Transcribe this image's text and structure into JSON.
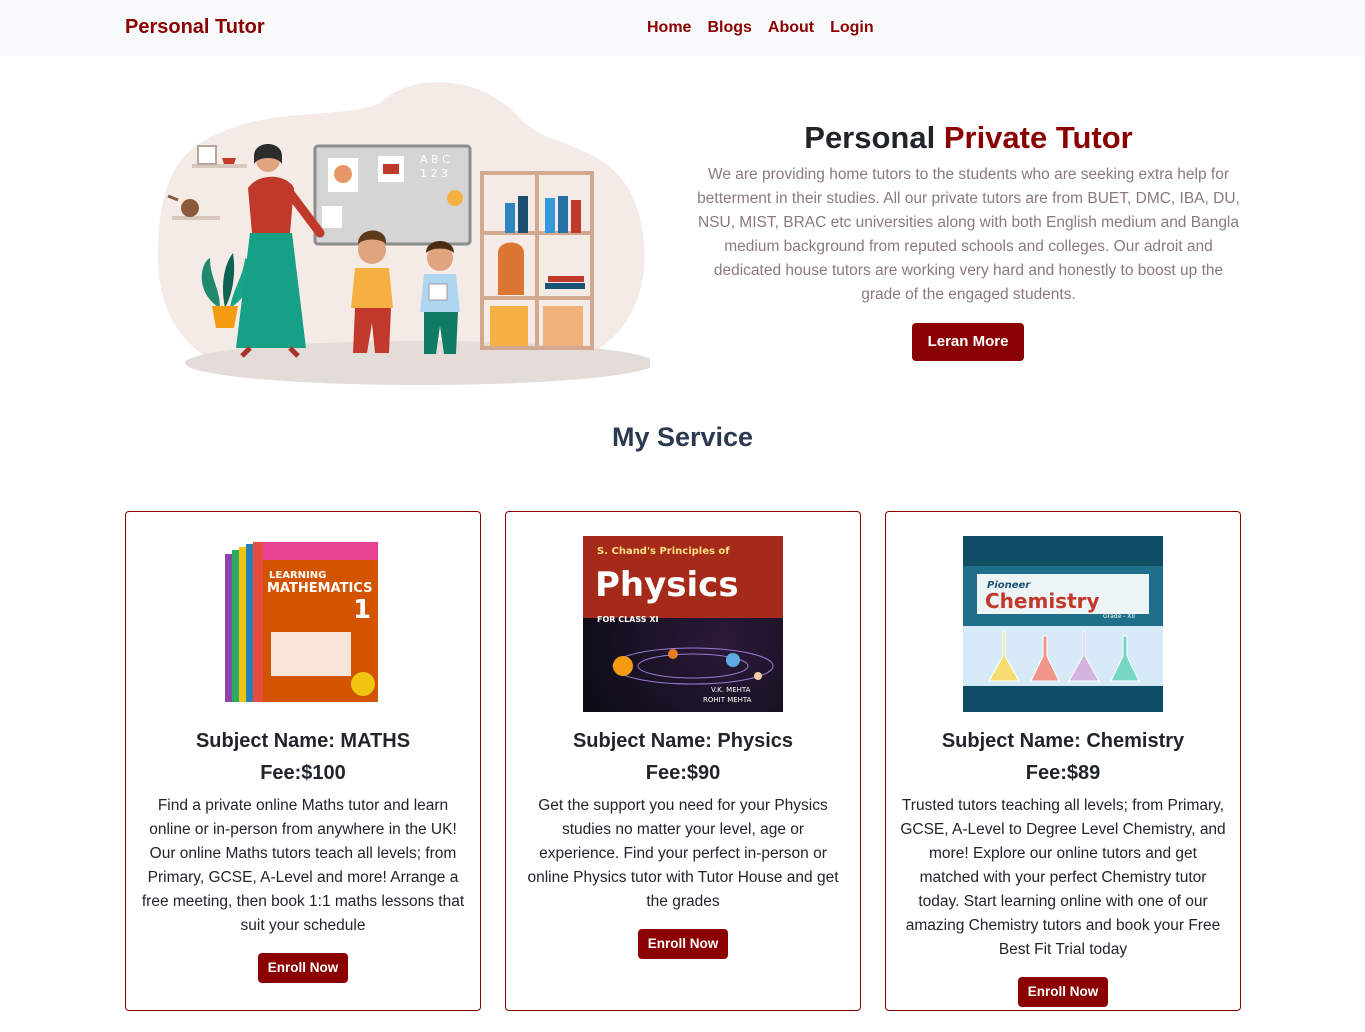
{
  "nav": {
    "brand": "Personal Tutor",
    "links": [
      "Home",
      "Blogs",
      "About",
      "Login"
    ]
  },
  "hero": {
    "title_part1": "Personal ",
    "title_part2": "Private Tutor",
    "description": "We are providing home tutors to the students who are seeking extra help for betterment in their studies. All our private tutors are from BUET, DMC, IBA, DU, NSU, MIST, BRAC etc universities along with both English medium and Bangla medium background from reputed schools and colleges. Our adroit and dedicated house tutors are working very hard and honestly to boost up the grade of the engaged students.",
    "button": "Leran More",
    "illustration_board_text": [
      "A B C",
      "1 2 3"
    ]
  },
  "services": {
    "title": "My Service",
    "cards": [
      {
        "subject": "Subject Name: MATHS",
        "fee": "Fee:$100",
        "description": "Find a private online Maths tutor and learn online or in-person from anywhere in the UK! Our online Maths tutors teach all levels; from Primary, GCSE, A-Level and more! Arrange a free meeting, then book 1:1 maths lessons that suit your schedule",
        "button": "Enroll Now",
        "book_title_line1": "LEARNING",
        "book_title_line2": "MATHEMATICS",
        "book_number": "1"
      },
      {
        "subject": "Subject Name: Physics",
        "fee": "Fee:$90",
        "description": "Get the support you need for your Physics studies no matter your level, age or experience. Find your perfect in-person or online Physics tutor with Tutor House and get the grades",
        "button": "Enroll Now",
        "book_title_line1": "S. Chand's Principles of",
        "book_title_line2": "Physics",
        "book_subtitle": "FOR CLASS XI",
        "book_authors": [
          "V.K. MEHTA",
          "ROHIT MEHTA"
        ]
      },
      {
        "subject": "Subject Name: Chemistry",
        "fee": "Fee:$89",
        "description": "Trusted tutors teaching all levels; from Primary, GCSE, A-Level to Degree Level Chemistry, and more! Explore our online tutors and get matched with your perfect Chemistry tutor today. Start learning online with one of our amazing Chemistry tutors and book your Free Best Fit Trial today",
        "button": "Enroll Now",
        "book_title_line1": "Pioneer",
        "book_title_line2": "Chemistry",
        "book_grade": "Grade - XII"
      }
    ]
  },
  "colors": {
    "accent": "#8b0000",
    "navbar_bg": "#f8f9fa",
    "muted_text": "#8a7a7a"
  }
}
